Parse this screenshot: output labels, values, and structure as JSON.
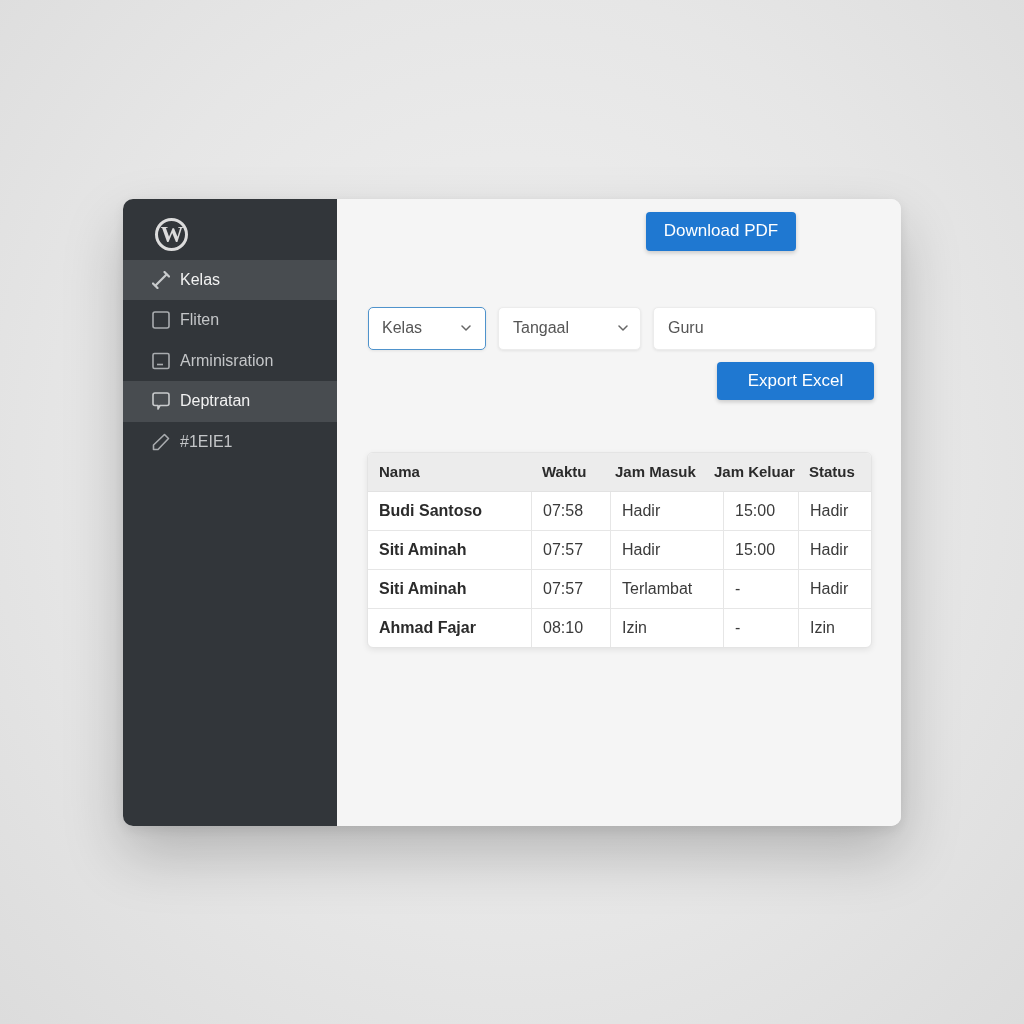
{
  "sidebar": {
    "logo": {
      "letter": "W"
    },
    "items": [
      {
        "label": "Kelas",
        "selected": true
      },
      {
        "label": "Fliten",
        "selected": false
      },
      {
        "label": "Arminisration",
        "selected": false
      },
      {
        "label": "Deptratan",
        "selected": true
      },
      {
        "label": "#1EIE1",
        "selected": false
      }
    ]
  },
  "download_button": {
    "label": "Download PDF"
  },
  "filters": [
    {
      "kind": "dropdown",
      "label": "Kelas",
      "focused": true
    },
    {
      "kind": "dropdown",
      "label": "Tangaal",
      "focused": false
    },
    {
      "kind": "input",
      "placeholder": "Guru",
      "focused": false
    }
  ],
  "export_button": {
    "label": "Export Excel"
  },
  "table": {
    "columns": [
      "Nama",
      "Waktu",
      "Jam Masuk",
      "Jam Keluar",
      "Status"
    ],
    "rows": [
      [
        "Budi Santoso",
        "07:58",
        "Hadir",
        "15:00",
        "Hadir"
      ],
      [
        "Siti Aminah",
        "07:57",
        "Hadir",
        "15:00",
        "Hadir"
      ],
      [
        "Siti Aminah",
        "07:57",
        "Terlambat",
        "-",
        "Hadir"
      ],
      [
        "Ahmad Fajar",
        "08:10",
        "Izin",
        "-",
        "Izin"
      ]
    ]
  }
}
